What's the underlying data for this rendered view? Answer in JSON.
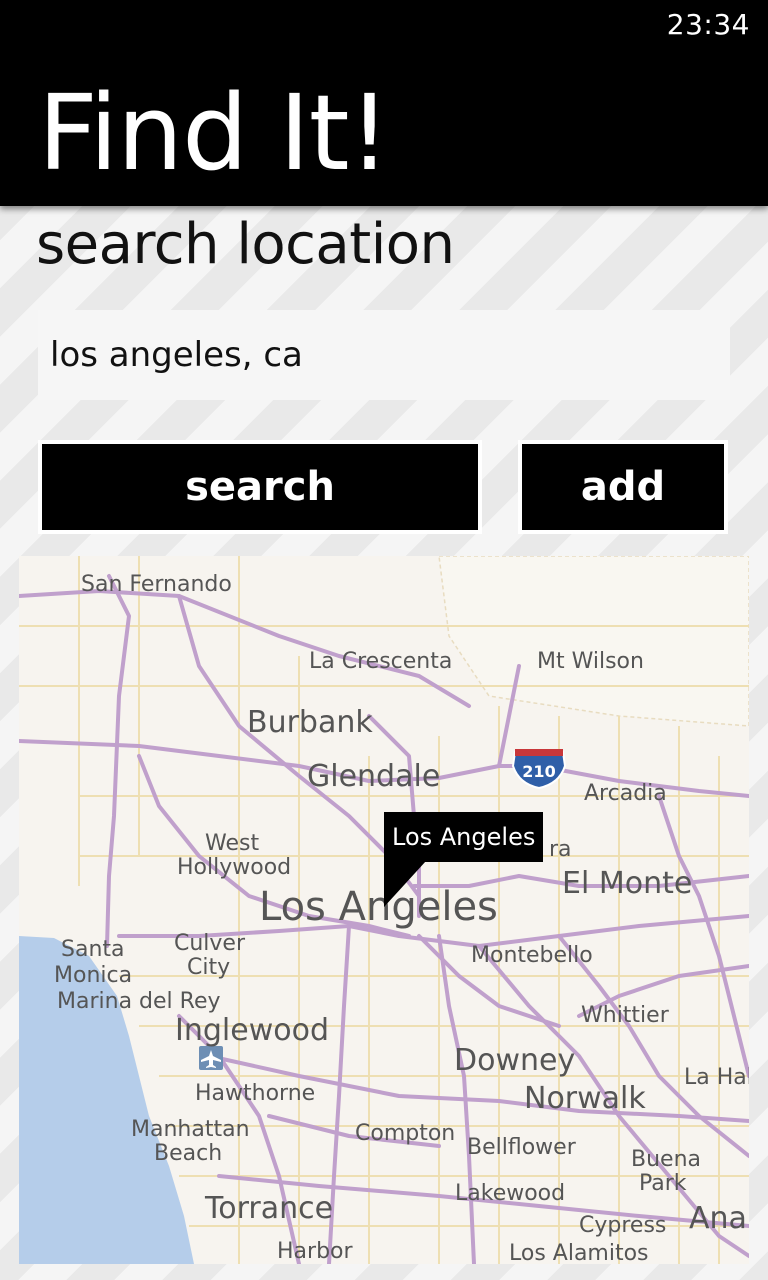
{
  "status_bar": {
    "time": "23:34"
  },
  "header": {
    "title": "Find It!"
  },
  "page": {
    "title": "search location"
  },
  "search": {
    "value": "los angeles, ca",
    "placeholder": ""
  },
  "buttons": {
    "search_label": "search",
    "add_label": "add"
  },
  "map": {
    "pin_label": "Los Angeles",
    "shield_label": "210",
    "places": {
      "san_fernando": "San Fernando",
      "la_crescenta": "La Crescenta",
      "mt_wilson": "Mt Wilson",
      "burbank": "Burbank",
      "glendale": "Glendale",
      "arcadia": "Arcadia",
      "west": "West",
      "hollywood": "Hollywood",
      "ra": "ra",
      "el_monte": "El Monte",
      "los_angeles": "Los Angeles",
      "santa": "Santa",
      "monica": "Monica",
      "culver": "Culver",
      "city": "City",
      "marina_del_rey": "Marina del Rey",
      "montebello": "Montebello",
      "inglewood": "Inglewood",
      "whittier": "Whittier",
      "downey": "Downey",
      "hawthorne": "Hawthorne",
      "norwalk": "Norwalk",
      "la_hab": "La Hab",
      "manhattan": "Manhattan",
      "beach": "Beach",
      "compton": "Compton",
      "bellflower": "Bellflower",
      "buena": "Buena",
      "park": "Park",
      "lakewood": "Lakewood",
      "torrance": "Torrance",
      "cypress": "Cypress",
      "ana": "Ana",
      "harbor": "Harbor",
      "los_alamitos": "Los Alamitos"
    },
    "colors": {
      "highway": "#c0a0cc",
      "road": "#eedfb2",
      "water": "#b5cdea",
      "land": "#f7f4ef"
    }
  }
}
